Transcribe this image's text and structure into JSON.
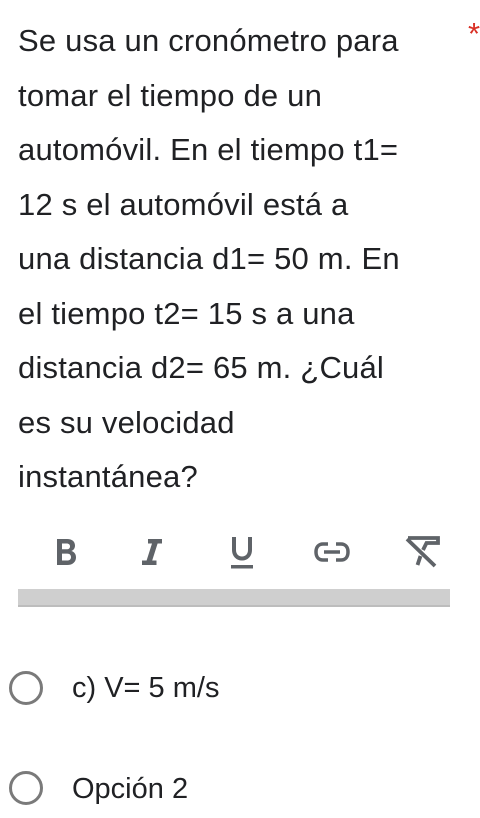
{
  "question": {
    "lines": [
      "Se usa un cronómetro para",
      "tomar el tiempo de un",
      "automóvil. En el tiempo t1=",
      "12 s el automóvil está a",
      "una distancia d1= 50 m. En",
      "el tiempo t2= 15 s a una",
      "distancia d2= 65 m. ¿Cuál",
      "es su velocidad",
      "instantánea?"
    ],
    "required_marker": "*"
  },
  "toolbar": {
    "buttons": [
      {
        "name": "bold-icon"
      },
      {
        "name": "italic-icon"
      },
      {
        "name": "underline-icon"
      },
      {
        "name": "link-icon"
      },
      {
        "name": "clear-formatting-icon"
      }
    ]
  },
  "answer": {
    "value": ""
  },
  "options": [
    {
      "label": "c) V= 5 m/s",
      "selected": false
    },
    {
      "label": "Opción 2",
      "selected": false
    }
  ]
}
